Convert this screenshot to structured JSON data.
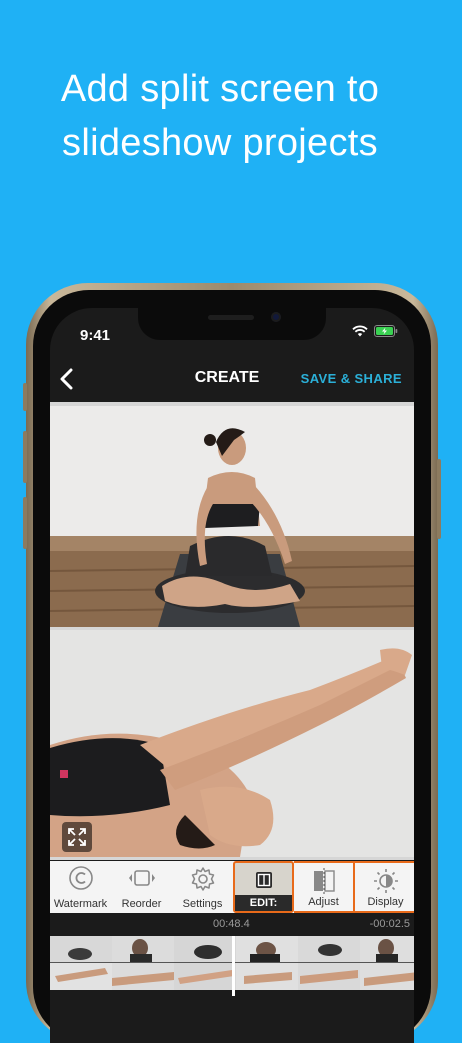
{
  "headline": {
    "line1": "Add split screen to",
    "line2": "slideshow projects"
  },
  "status_bar": {
    "time": "9:41"
  },
  "navbar": {
    "title": "CREATE",
    "share_label": "SAVE & SHARE"
  },
  "toolbar": {
    "items": [
      {
        "label": "Watermark",
        "icon": "copyright-icon"
      },
      {
        "label": "Reorder",
        "icon": "reorder-icon"
      },
      {
        "label": "Settings",
        "icon": "gear-icon"
      },
      {
        "label": "EDIT:",
        "icon": "split-screen-icon",
        "selected": true
      },
      {
        "label": "Adjust",
        "icon": "adjust-split-icon"
      },
      {
        "label": "Display",
        "icon": "brightness-icon"
      }
    ]
  },
  "timeline": {
    "elapsed": "00:48.4",
    "remaining": "-00:02.5"
  },
  "colors": {
    "background": "#1fb1f5",
    "accent": "#2bb0d8",
    "edit_highlight": "#e86a1a"
  }
}
